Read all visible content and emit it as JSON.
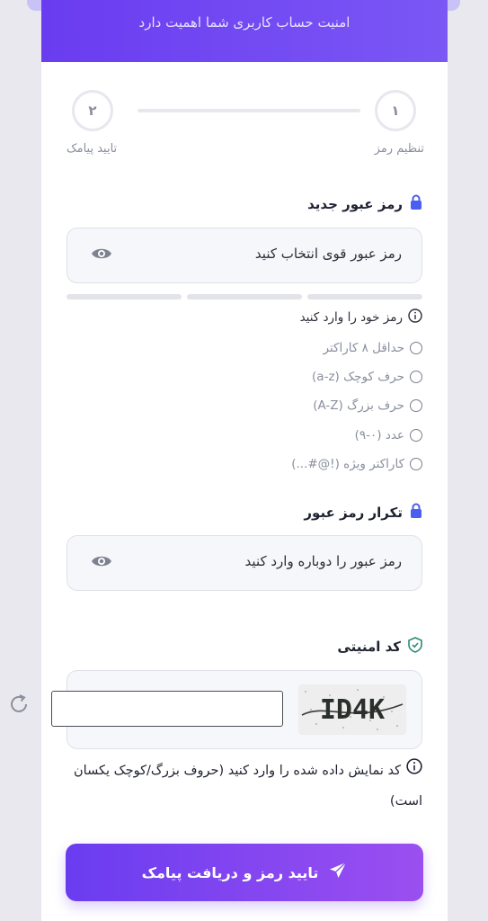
{
  "header": {
    "subtitle": "امنیت حساب کاربری شما اهمیت دارد"
  },
  "stepper": {
    "steps": [
      {
        "number": "۱",
        "label": "تنظیم رمز"
      },
      {
        "number": "۲",
        "label": "تایید پیامک"
      }
    ]
  },
  "new_password": {
    "title": "رمز عبور جدید",
    "placeholder": "رمز عبور قوی انتخاب کنید",
    "hint": "رمز خود را وارد کنید",
    "requirements": [
      "حداقل ۸ کاراکتر",
      "حرف کوچک (a-z)",
      "حرف بزرگ (A-Z)",
      "عدد (۰-۹)",
      "کاراکتر ویژه (!@#...)"
    ]
  },
  "confirm_password": {
    "title": "تکرار رمز عبور",
    "placeholder": "رمز عبور را دوباره وارد کنید"
  },
  "captcha": {
    "title": "کد امنیتی",
    "image_text": "ID4K",
    "input_value": "",
    "note": "کد نمایش داده شده را وارد کنید (حروف بزرگ/کوچک یکسان است)"
  },
  "submit": {
    "label": "تایید رمز و دریافت پیامک"
  },
  "colors": {
    "accent": "#6a3cf0",
    "accent2": "#9b4ff0",
    "lock": "#4a5ef0"
  }
}
